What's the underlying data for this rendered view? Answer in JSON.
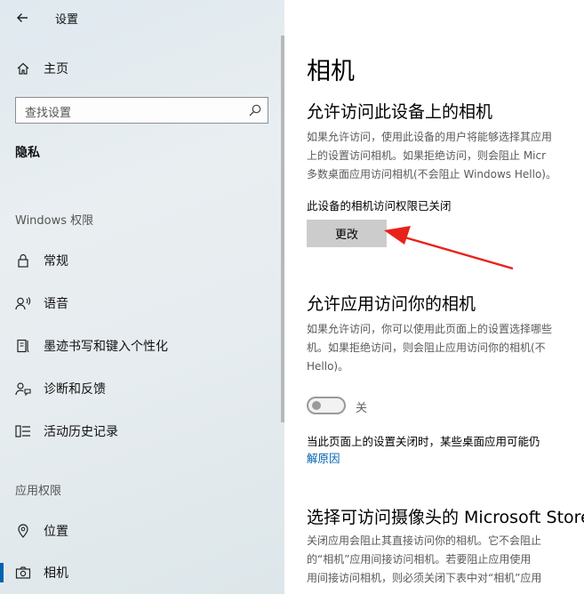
{
  "window": {
    "title": "设置"
  },
  "sidebar": {
    "home_label": "主页",
    "search_placeholder": "查找设置",
    "section_title": "隐私",
    "windows_group": "Windows 权限",
    "windows_items": [
      {
        "label": "常规",
        "icon": "lock-icon"
      },
      {
        "label": "语音",
        "icon": "speech-icon"
      },
      {
        "label": "墨迹书写和键入个性化",
        "icon": "pen-icon"
      },
      {
        "label": "诊断和反馈",
        "icon": "feedback-icon"
      },
      {
        "label": "活动历史记录",
        "icon": "history-icon"
      }
    ],
    "app_group": "应用权限",
    "app_items": [
      {
        "label": "位置",
        "icon": "location-icon"
      },
      {
        "label": "相机",
        "icon": "camera-icon",
        "selected": true
      }
    ]
  },
  "main": {
    "page_title": "相机",
    "section1": {
      "heading": "允许访问此设备上的相机",
      "desc_lines": [
        "如果允许访问，使用此设备的用户将能够选择其应用",
        "上的设置访问相机。如果拒绝访问，则会阻止 Micr",
        "多数桌面应用访问相机(不会阻止 Windows Hello)。"
      ],
      "status": "此设备的相机访问权限已关闭",
      "button_label": "更改"
    },
    "section2": {
      "heading": "允许应用访问你的相机",
      "desc_lines": [
        "如果允许访问，你可以使用此页面上的设置选择哪些",
        "机。如果拒绝访问，则会阻止应用访问你的相机(不",
        "Hello)。"
      ],
      "toggle_state": "关",
      "note": "当此页面上的设置关闭时，某些桌面应用可能仍",
      "link_text": "解原因"
    },
    "section3": {
      "heading": "选择可访问摄像头的 Microsoft Store",
      "desc_lines": [
        "关闭应用会阻止其直接访问你的相机。它不会阻止",
        "的“相机”应用间接访问相机。若要阻止应用使用",
        "用间接访问相机，则必须关闭下表中对“相机”应用"
      ]
    }
  },
  "colors": {
    "accent": "#0063b1",
    "arrow": "#e8221a",
    "button_bg": "#cccccc"
  }
}
